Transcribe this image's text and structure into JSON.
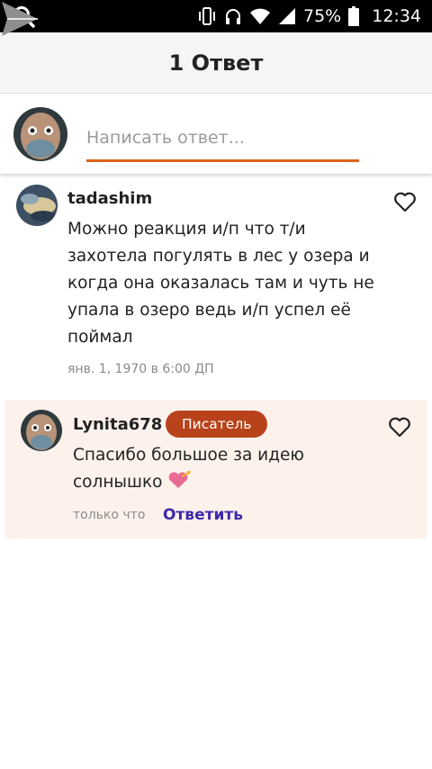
{
  "status_bar": {
    "battery": "75%",
    "time": "12:34"
  },
  "header": {
    "title": "1 Ответ"
  },
  "compose": {
    "placeholder": "Написать ответ..."
  },
  "comment": {
    "username": "tadashim",
    "lines": [
      "Можно реакция и/п что т/и",
      "захотела погулять в лес у озера и",
      "когда она оказалась там и чуть не",
      "упала в озеро ведь и/п успел её",
      "поймал"
    ],
    "timestamp": "янв. 1, 1970 в 6:00 ДП"
  },
  "reply": {
    "username": "Lynita678",
    "badge": "Писатель",
    "lines": [
      "Спасибо большое за идею",
      "солнышко"
    ],
    "timestamp": "только что",
    "reply_label": "Ответить"
  },
  "colors": {
    "accent": "#e0641d",
    "badge": "#b8431b",
    "link": "#3d2aa8",
    "reply_bg": "#fdf1ec"
  },
  "icons": [
    "search-icon",
    "vibrate-icon",
    "headphones-icon",
    "wifi-icon",
    "signal-icon",
    "battery-icon",
    "send-icon",
    "heart-outline-icon",
    "heart-emoji-icon"
  ]
}
